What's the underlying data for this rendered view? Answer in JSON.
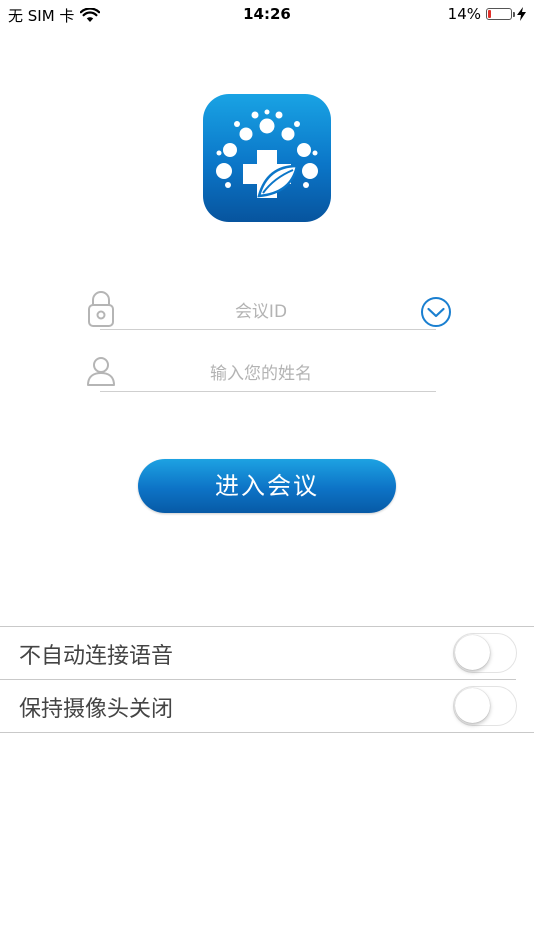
{
  "status_bar": {
    "carrier": "无 SIM 卡",
    "time": "14:26",
    "battery_percent": "14%",
    "battery_level": 0.14,
    "icons": [
      "wifi-icon",
      "battery-icon",
      "charging-bolt-icon"
    ]
  },
  "logo": {
    "icon": "medical-cross-leaf-logo",
    "colors": [
      "#19a3e4",
      "#07549e"
    ]
  },
  "form": {
    "meeting_id": {
      "placeholder": "会议ID",
      "value": "",
      "icon": "lock-icon",
      "dropdown_icon": "chevron-down-icon"
    },
    "name": {
      "placeholder": "输入您的姓名",
      "value": "",
      "icon": "user-icon"
    }
  },
  "enter_button": {
    "label": "进入会议",
    "color": "#0d73c6"
  },
  "settings": [
    {
      "label": "不自动连接语音",
      "enabled": false
    },
    {
      "label": "保持摄像头关闭",
      "enabled": false
    }
  ]
}
